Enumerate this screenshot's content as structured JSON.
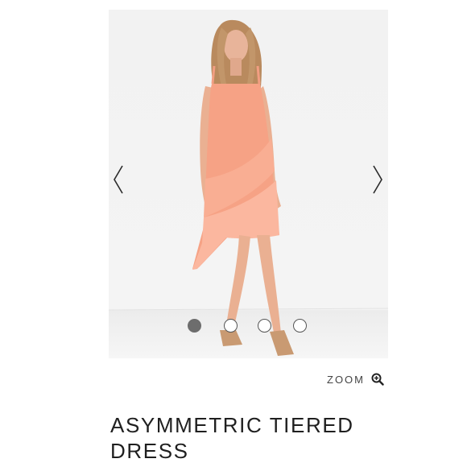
{
  "gallery": {
    "image_alt": "Woman wearing a coral asymmetric tiered dress",
    "prev_icon": "chevron-left-icon",
    "next_icon": "chevron-right-icon",
    "slide_count": 4,
    "active_slide": 1
  },
  "zoom": {
    "label": "ZOOM",
    "icon": "zoom-in-icon"
  },
  "product": {
    "title": "ASYMMETRIC TIERED DRESS"
  },
  "colors": {
    "dress": "#f7a589",
    "background": "#f2f2f2",
    "active_dot": "#6d6d6d"
  }
}
